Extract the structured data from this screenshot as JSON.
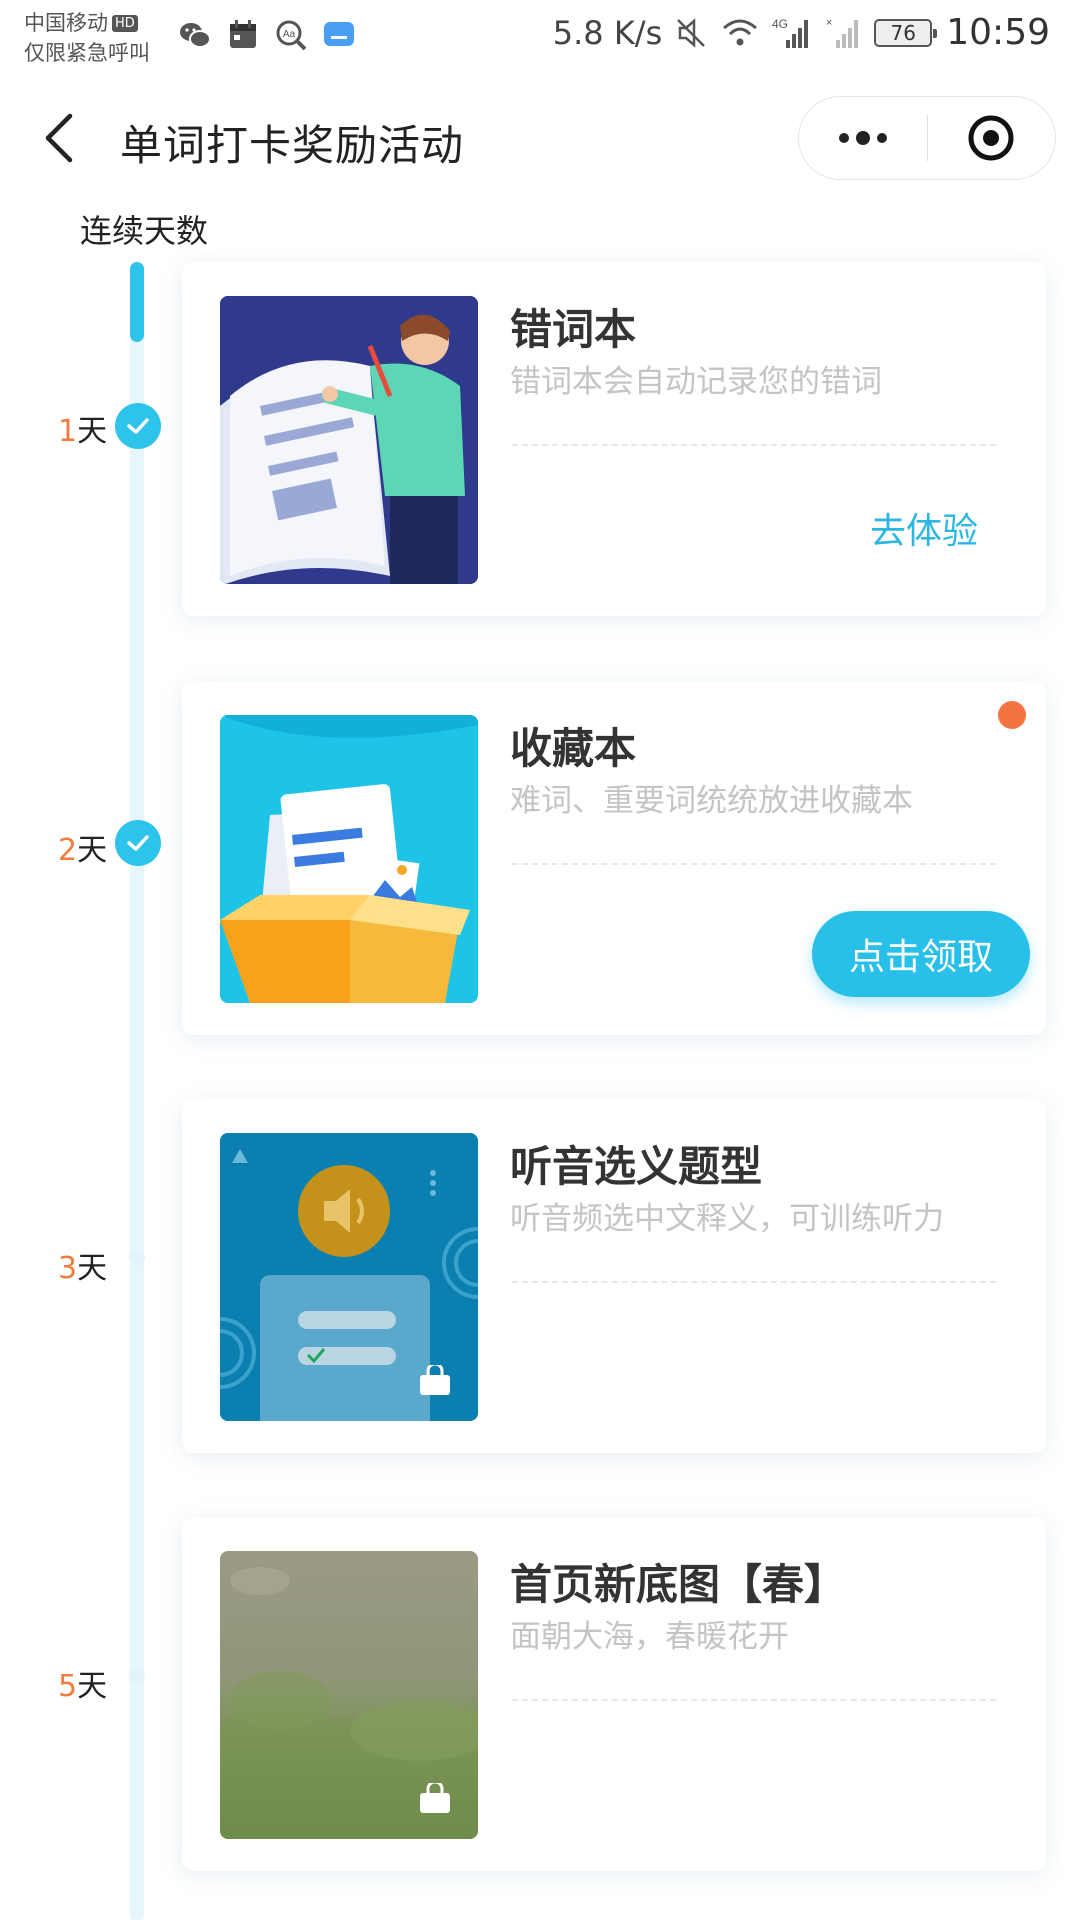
{
  "status_bar": {
    "carrier": "中国移动",
    "hd": "HD",
    "emergency": "仅限紧急呼叫",
    "net_speed": "5.8 K/s",
    "battery": "76",
    "time": "10:59"
  },
  "nav": {
    "title": "单词打卡奖励活动"
  },
  "timeline": {
    "label": "连续天数",
    "day_unit": "天"
  },
  "cards": [
    {
      "day": "1",
      "title": "错词本",
      "desc": "错词本会自动记录您的错词",
      "action": "去体验",
      "status": "completed"
    },
    {
      "day": "2",
      "title": "收藏本",
      "desc": "难词、重要词统统放进收藏本",
      "action": "点击领取",
      "status": "claimable"
    },
    {
      "day": "3",
      "title": "听音选义题型",
      "desc": "听音频选中文释义，可训练听力",
      "status": "locked"
    },
    {
      "day": "5",
      "title": "首页新底图【春】",
      "desc": "面朝大海，春暖花开",
      "status": "locked"
    }
  ],
  "colors": {
    "accent": "#2ec3ea",
    "day_number": "#f07c3e",
    "notification_dot": "#f47440"
  }
}
